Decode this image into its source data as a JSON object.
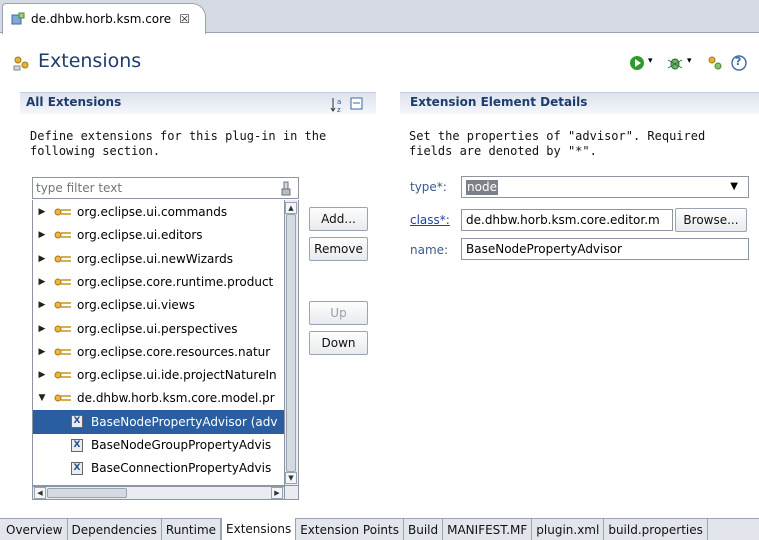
{
  "editor_tab": {
    "title": "de.dhbw.horb.ksm.core",
    "icon": "plugin-icon",
    "close": "☒"
  },
  "header": {
    "title": "Extensions",
    "icon": "extensions-icon",
    "toolbar": [
      "run-icon",
      "debug-icon",
      "extension-wizard-icon",
      "help-icon"
    ],
    "help_glyph": "?"
  },
  "left_section": {
    "title": "All Extensions",
    "sort_icon": "sort-alpha-icon",
    "collapse_icon": "collapse-all-icon",
    "description": "Define extensions for this plug-in in the\nfollowing section.",
    "filter_placeholder": "type filter text",
    "tree": [
      {
        "label": "org.eclipse.ui.commands",
        "expanded": false,
        "level": 0
      },
      {
        "label": "org.eclipse.ui.editors",
        "expanded": false,
        "level": 0
      },
      {
        "label": "org.eclipse.ui.newWizards",
        "expanded": false,
        "level": 0
      },
      {
        "label": "org.eclipse.core.runtime.product",
        "expanded": false,
        "level": 0
      },
      {
        "label": "org.eclipse.ui.views",
        "expanded": false,
        "level": 0
      },
      {
        "label": "org.eclipse.ui.perspectives",
        "expanded": false,
        "level": 0
      },
      {
        "label": "org.eclipse.core.resources.natur",
        "expanded": false,
        "level": 0
      },
      {
        "label": "org.eclipse.ui.ide.projectNatureIn",
        "expanded": false,
        "level": 0
      },
      {
        "label": "de.dhbw.horb.ksm.core.model.pr",
        "expanded": true,
        "level": 0
      },
      {
        "label": "BaseNodePropertyAdvisor (adv",
        "level": 1,
        "selected": true
      },
      {
        "label": "BaseNodeGroupPropertyAdvis",
        "level": 1
      },
      {
        "label": "BaseConnectionPropertyAdvis",
        "level": 1
      }
    ],
    "buttons": {
      "add": "Add...",
      "remove": "Remove",
      "up": "Up",
      "down": "Down"
    }
  },
  "right_section": {
    "title": "Extension Element Details",
    "description": "Set the properties of \"advisor\". Required\nfields are denoted by \"*\".",
    "fields": {
      "type_label": "type*:",
      "type_value": "node",
      "class_label": "class*:",
      "class_value": "de.dhbw.horb.ksm.core.editor.m",
      "browse_label": "Browse...",
      "name_label": "name:",
      "name_value": "BaseNodePropertyAdvisor"
    }
  },
  "bottom_tabs": [
    "Overview",
    "Dependencies",
    "Runtime",
    "Extensions",
    "Extension Points",
    "Build",
    "MANIFEST.MF",
    "plugin.xml",
    "build.properties"
  ],
  "active_bottom_tab": "Extensions",
  "colors": {
    "title_blue": "#1e3c6e",
    "selection": "#2a5ea0",
    "link": "#1f3f9e"
  }
}
